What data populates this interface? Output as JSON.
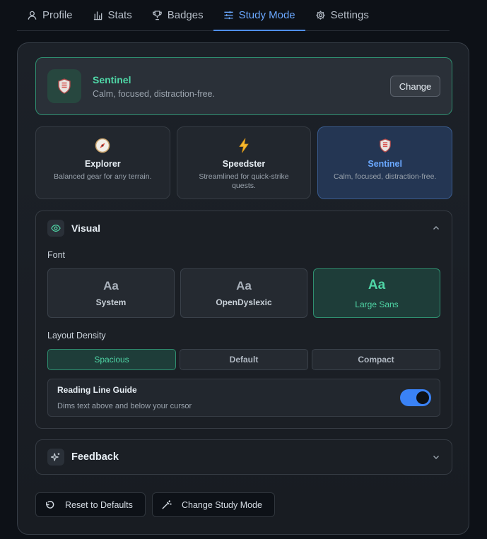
{
  "tabs": [
    {
      "label": "Profile",
      "icon": "user-icon"
    },
    {
      "label": "Stats",
      "icon": "bar-chart-icon"
    },
    {
      "label": "Badges",
      "icon": "trophy-icon"
    },
    {
      "label": "Study Mode",
      "icon": "sliders-icon",
      "active": true
    },
    {
      "label": "Settings",
      "icon": "gear-icon"
    }
  ],
  "selected": {
    "title": "Sentinel",
    "description": "Calm, focused, distraction-free.",
    "change_label": "Change"
  },
  "modes": [
    {
      "name": "Explorer",
      "description": "Balanced gear for any terrain.",
      "icon": "compass-icon"
    },
    {
      "name": "Speedster",
      "description": "Streamlined for quick-strike quests.",
      "icon": "lightning-icon"
    },
    {
      "name": "Sentinel",
      "description": "Calm, focused, distraction-free.",
      "icon": "shield-icon",
      "active": true
    }
  ],
  "visual": {
    "title": "Visual",
    "font_label": "Font",
    "fonts": [
      {
        "sample": "Aa",
        "name": "System"
      },
      {
        "sample": "Aa",
        "name": "OpenDyslexic"
      },
      {
        "sample": "Aa",
        "name": "Large Sans",
        "active": true
      }
    ],
    "density_label": "Layout Density",
    "density": [
      {
        "label": "Spacious",
        "active": true
      },
      {
        "label": "Default"
      },
      {
        "label": "Compact"
      }
    ],
    "guide": {
      "title": "Reading Line Guide",
      "description": "Dims text above and below your cursor",
      "enabled": true
    }
  },
  "feedback": {
    "title": "Feedback"
  },
  "actions": {
    "reset_label": "Reset to Defaults",
    "change_mode_label": "Change Study Mode"
  },
  "colors": {
    "accent_green": "#4fd6a6",
    "accent_blue": "#6aa8ff",
    "toggle_on": "#3a82f6",
    "background": "#0d1117"
  }
}
